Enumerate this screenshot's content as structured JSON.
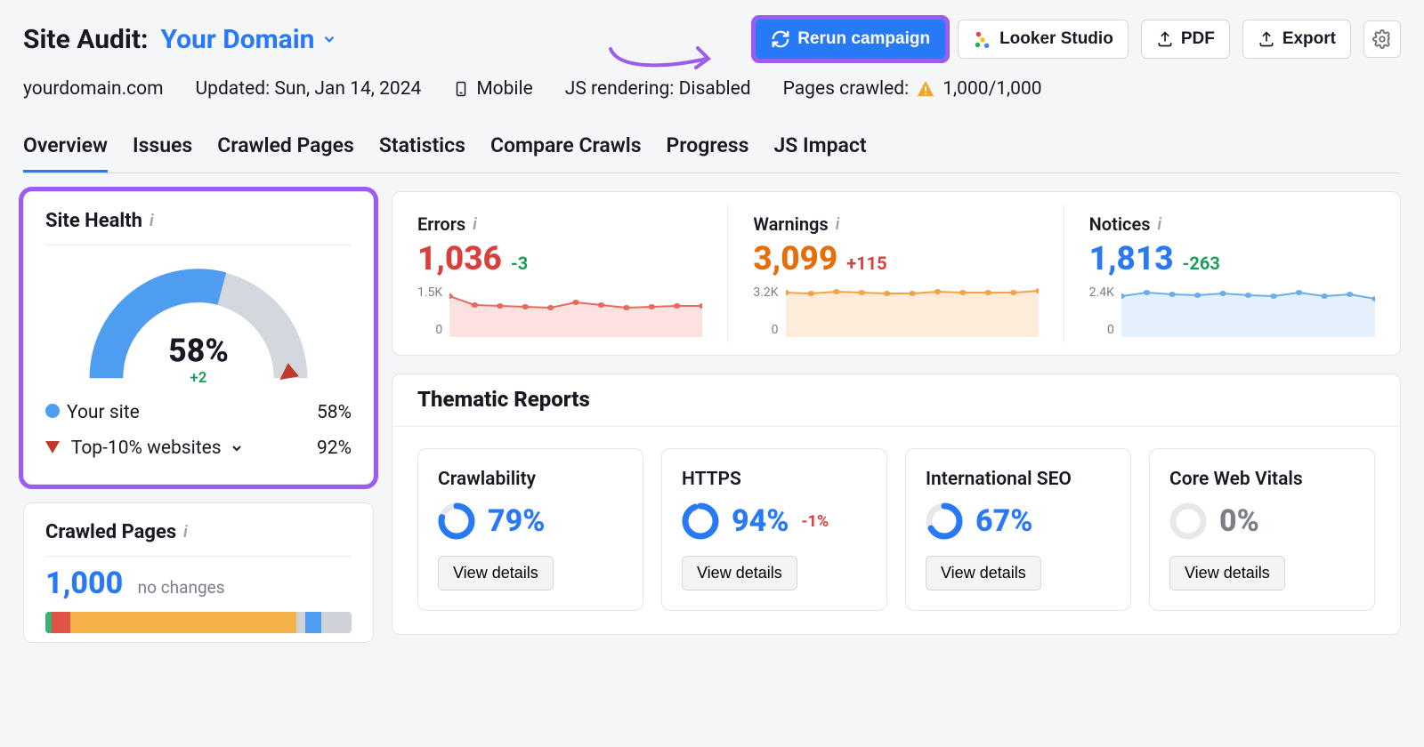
{
  "header": {
    "title_prefix": "Site Audit:",
    "domain_label": "Your Domain",
    "rerun_label": "Rerun campaign",
    "looker_label": "Looker Studio",
    "pdf_label": "PDF",
    "export_label": "Export"
  },
  "meta": {
    "domain": "yourdomain.com",
    "updated": "Updated: Sun, Jan 14, 2024",
    "device": "Mobile",
    "js_render": "JS rendering: Disabled",
    "pages_crawled_label": "Pages crawled:",
    "pages_crawled_value": "1,000/1,000"
  },
  "tabs": [
    "Overview",
    "Issues",
    "Crawled Pages",
    "Statistics",
    "Compare Crawls",
    "Progress",
    "JS Impact"
  ],
  "site_health": {
    "title": "Site Health",
    "value": "58%",
    "delta": "+2",
    "your_site_label": "Your site",
    "your_site_value": "58%",
    "top10_label": "Top-10% websites",
    "top10_value": "92%"
  },
  "stats": {
    "errors": {
      "label": "Errors",
      "value": "1,036",
      "delta": "-3",
      "color": "#d9403b",
      "delta_color": "#1a9e5a",
      "axis_max": "1.5K",
      "axis_min": "0",
      "fill": "#fbe2e0",
      "stroke": "#e46a62"
    },
    "warnings": {
      "label": "Warnings",
      "value": "3,099",
      "delta": "+115",
      "color": "#e36e0a",
      "delta_color": "#d9403b",
      "axis_max": "3.2K",
      "axis_min": "0",
      "fill": "#fdecd9",
      "stroke": "#f4a24a"
    },
    "notices": {
      "label": "Notices",
      "value": "1,813",
      "delta": "-263",
      "color": "#2879f6",
      "delta_color": "#1a9e5a",
      "axis_max": "2.4K",
      "axis_min": "0",
      "fill": "#e4f1fc",
      "stroke": "#6caeea"
    }
  },
  "chart_data": [
    {
      "type": "line",
      "title": "Errors",
      "ylim": [
        0,
        1500
      ],
      "x": [
        1,
        2,
        3,
        4,
        5,
        6,
        7,
        8,
        9,
        10
      ],
      "values": [
        1200,
        1040,
        1030,
        1020,
        1010,
        1080,
        1050,
        1020,
        1030,
        1036
      ]
    },
    {
      "type": "line",
      "title": "Warnings",
      "ylim": [
        0,
        3200
      ],
      "x": [
        1,
        2,
        3,
        4,
        5,
        6,
        7,
        8,
        9,
        10
      ],
      "values": [
        3000,
        2980,
        3050,
        3000,
        2970,
        2980,
        3050,
        3020,
        3000,
        3099
      ]
    },
    {
      "type": "line",
      "title": "Notices",
      "ylim": [
        0,
        2400
      ],
      "x": [
        1,
        2,
        3,
        4,
        5,
        6,
        7,
        8,
        9,
        10
      ],
      "values": [
        2000,
        2100,
        2050,
        2020,
        2080,
        2040,
        2020,
        2100,
        2000,
        1813
      ]
    }
  ],
  "thematic": {
    "title": "Thematic Reports",
    "view_label": "View details",
    "reports": [
      {
        "title": "Crawlability",
        "pct": "79%",
        "pct_num": 79,
        "delta": ""
      },
      {
        "title": "HTTPS",
        "pct": "94%",
        "pct_num": 94,
        "delta": "-1%"
      },
      {
        "title": "International SEO",
        "pct": "67%",
        "pct_num": 67,
        "delta": ""
      },
      {
        "title": "Core Web Vitals",
        "pct": "0%",
        "pct_num": 0,
        "delta": ""
      }
    ]
  },
  "crawled_pages": {
    "title": "Crawled Pages",
    "value": "1,000",
    "no_change": "no changes",
    "bar": [
      {
        "color": "#3bb273",
        "w": 2
      },
      {
        "color": "#e15247",
        "w": 6
      },
      {
        "color": "#f5b24a",
        "w": 74
      },
      {
        "color": "#cfd3d9",
        "w": 3
      },
      {
        "color": "#4f9df0",
        "w": 5
      },
      {
        "color": "#cfd3d9",
        "w": 10
      }
    ]
  }
}
